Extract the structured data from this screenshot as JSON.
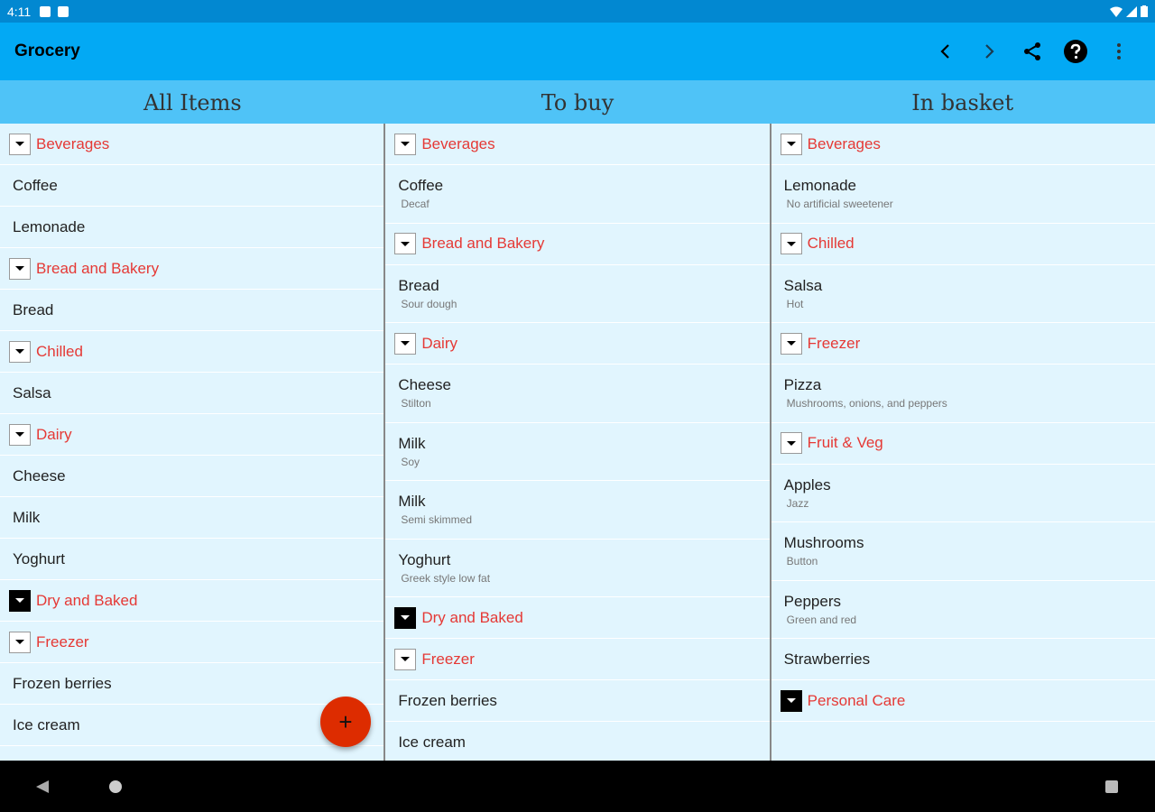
{
  "status_bar": {
    "time": "4:11"
  },
  "app_bar": {
    "title": "Grocery",
    "actions": [
      "chevron-left-icon",
      "chevron-right-icon",
      "share-icon",
      "help-icon",
      "more-vert-icon"
    ]
  },
  "columns": [
    {
      "header": "All Items",
      "rows": [
        {
          "type": "category",
          "label": "Beverages",
          "collapsed": false
        },
        {
          "type": "item",
          "name": "Coffee"
        },
        {
          "type": "item",
          "name": "Lemonade"
        },
        {
          "type": "category",
          "label": "Bread and Bakery",
          "collapsed": false
        },
        {
          "type": "item",
          "name": "Bread"
        },
        {
          "type": "category",
          "label": "Chilled",
          "collapsed": false
        },
        {
          "type": "item",
          "name": "Salsa"
        },
        {
          "type": "category",
          "label": "Dairy",
          "collapsed": false
        },
        {
          "type": "item",
          "name": "Cheese"
        },
        {
          "type": "item",
          "name": "Milk"
        },
        {
          "type": "item",
          "name": "Yoghurt"
        },
        {
          "type": "category",
          "label": "Dry and Baked",
          "collapsed": true
        },
        {
          "type": "category",
          "label": "Freezer",
          "collapsed": false
        },
        {
          "type": "item",
          "name": "Frozen berries"
        },
        {
          "type": "item",
          "name": "Ice cream"
        }
      ]
    },
    {
      "header": "To buy",
      "rows": [
        {
          "type": "category",
          "label": "Beverages",
          "collapsed": false
        },
        {
          "type": "item",
          "name": "Coffee",
          "note": "Decaf"
        },
        {
          "type": "category",
          "label": "Bread and Bakery",
          "collapsed": false
        },
        {
          "type": "item",
          "name": "Bread",
          "note": "Sour dough"
        },
        {
          "type": "category",
          "label": "Dairy",
          "collapsed": false
        },
        {
          "type": "item",
          "name": "Cheese",
          "note": "Stilton"
        },
        {
          "type": "item",
          "name": "Milk",
          "note": "Soy"
        },
        {
          "type": "item",
          "name": "Milk",
          "note": "Semi skimmed"
        },
        {
          "type": "item",
          "name": "Yoghurt",
          "note": "Greek style low fat"
        },
        {
          "type": "category",
          "label": "Dry and Baked",
          "collapsed": true
        },
        {
          "type": "category",
          "label": "Freezer",
          "collapsed": false
        },
        {
          "type": "item",
          "name": "Frozen berries"
        },
        {
          "type": "item",
          "name": "Ice cream"
        }
      ]
    },
    {
      "header": "In basket",
      "rows": [
        {
          "type": "category",
          "label": "Beverages",
          "collapsed": false
        },
        {
          "type": "item",
          "name": "Lemonade",
          "note": "No artificial sweetener"
        },
        {
          "type": "category",
          "label": "Chilled",
          "collapsed": false
        },
        {
          "type": "item",
          "name": "Salsa",
          "note": "Hot"
        },
        {
          "type": "category",
          "label": "Freezer",
          "collapsed": false
        },
        {
          "type": "item",
          "name": "Pizza",
          "note": "Mushrooms, onions, and peppers"
        },
        {
          "type": "category",
          "label": "Fruit & Veg",
          "collapsed": false
        },
        {
          "type": "item",
          "name": "Apples",
          "note": "Jazz"
        },
        {
          "type": "item",
          "name": "Mushrooms",
          "note": "Button"
        },
        {
          "type": "item",
          "name": "Peppers",
          "note": "Green and red"
        },
        {
          "type": "item",
          "name": "Strawberries"
        },
        {
          "type": "category",
          "label": "Personal Care",
          "collapsed": true
        }
      ]
    }
  ],
  "fab": {
    "label": "+"
  },
  "colors": {
    "appbar": "#03a9f4",
    "statusbar": "#0288d1",
    "header": "#4fc3f7",
    "list_bg": "#e1f5fe",
    "category_text": "#e53935",
    "fab": "#dd2c00"
  }
}
